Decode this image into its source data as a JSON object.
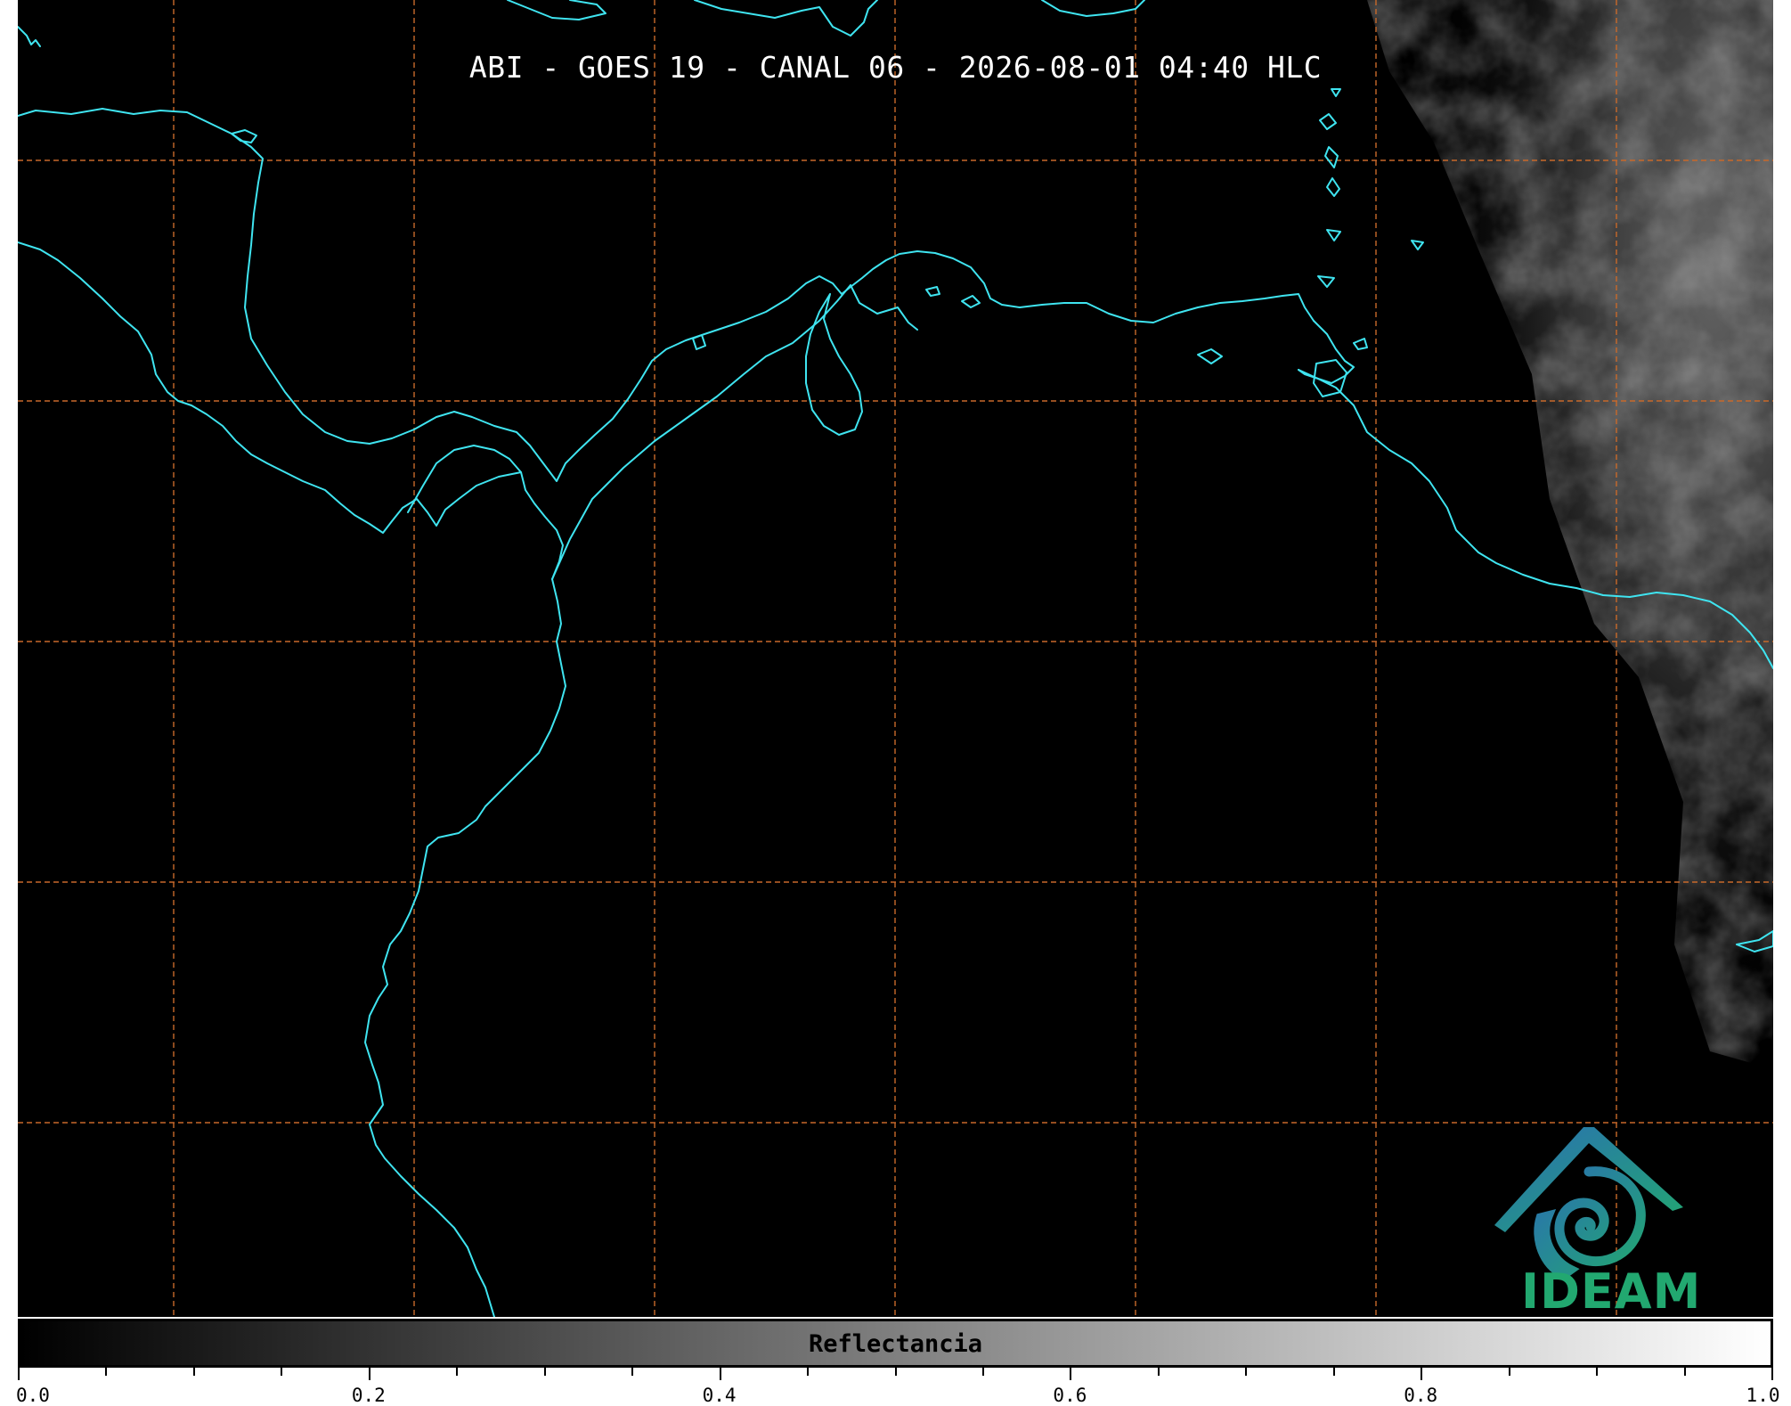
{
  "title": "ABI - GOES 19 - CANAL 06 - 2026-08-01 04:40 HLC",
  "colorbar": {
    "label": "Reflectancia",
    "range": [
      0.0,
      1.0
    ],
    "colormap": "grayscale (black to white)",
    "major_tick_labels": [
      "0.0",
      "0.2",
      "0.4",
      "0.6",
      "0.8",
      "1.0"
    ],
    "minor_tick_step": 0.05
  },
  "logo": {
    "text": "IDEAM",
    "color_primary": "#22a870",
    "color_secondary": "#2a6fb3"
  },
  "colors": {
    "background": "#000000",
    "coastline": "#3fe4f0",
    "graticule": "#c8692a",
    "cloud_texture": "#5a5a5a"
  },
  "map": {
    "graticule_style": "dashed",
    "features": [
      "coastlines",
      "island outlines",
      "lat/lon graticule",
      "cloud field (east)"
    ]
  }
}
